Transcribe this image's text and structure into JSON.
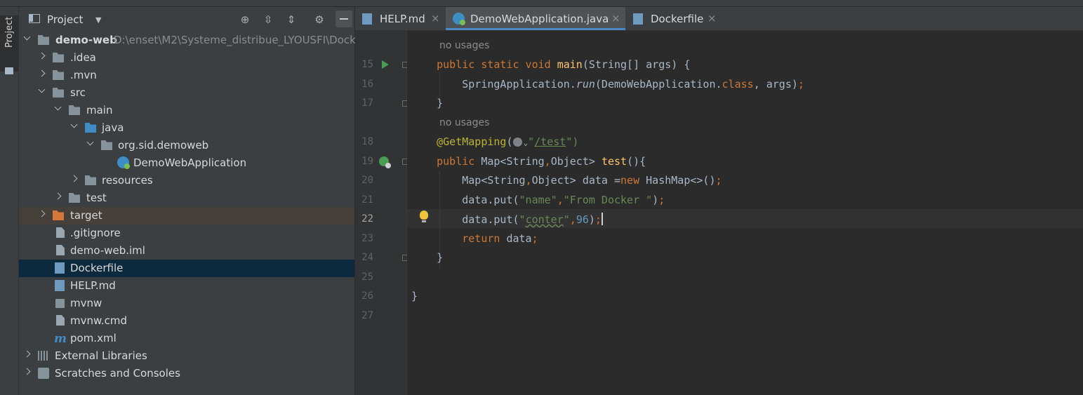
{
  "sidebar_strip": {
    "label": "Project"
  },
  "project_panel": {
    "title": "Project",
    "tree": [
      {
        "label": "demo-web",
        "path": "D:\\enset\\M2\\Systeme_distribue_LYOUSFI\\Dock"
      },
      {
        "label": ".idea"
      },
      {
        "label": ".mvn"
      },
      {
        "label": "src"
      },
      {
        "label": "main"
      },
      {
        "label": "java"
      },
      {
        "label": "org.sid.demoweb"
      },
      {
        "label": "DemoWebApplication"
      },
      {
        "label": "resources"
      },
      {
        "label": "test"
      },
      {
        "label": "target"
      },
      {
        "label": ".gitignore"
      },
      {
        "label": "demo-web.iml"
      },
      {
        "label": "Dockerfile"
      },
      {
        "label": "HELP.md"
      },
      {
        "label": "mvnw"
      },
      {
        "label": "mvnw.cmd"
      },
      {
        "label": "pom.xml"
      },
      {
        "label": "External Libraries"
      },
      {
        "label": "Scratches and Consoles"
      }
    ]
  },
  "tabs": [
    {
      "label": "HELP.md",
      "close": "×"
    },
    {
      "label": "DemoWebApplication.java",
      "close": "×"
    },
    {
      "label": "Dockerfile",
      "close": "×"
    }
  ],
  "editor": {
    "hint": "no usages",
    "line_numbers": [
      "15",
      "16",
      "17",
      "18",
      "19",
      "20",
      "21",
      "22",
      "23",
      "24",
      "25",
      "26",
      "27"
    ],
    "code": {
      "l15_kw": "public static void ",
      "l15_fn": "main",
      "l15_rest": "(String[] args) {",
      "l16_a": "SpringApplication.",
      "l16_run": "run",
      "l16_b": "(DemoWebApplication.",
      "l16_cls": "class",
      "l16_c": ", args)",
      "l16_semi": ";",
      "l17": "}",
      "l18_ann": "@GetMapping",
      "l18_open": "(",
      "l18_q": "\"",
      "l18_url": "/test",
      "l18_close": "\")",
      "l19_kw": "public ",
      "l19_type": "Map<String",
      "l19_comma": ",",
      "l19_type2": "Object> ",
      "l19_fn": "test",
      "l19_rest": "(){",
      "l20_a": "Map<String",
      "l20_comma": ",",
      "l20_b": "Object> data =",
      "l20_new": "new ",
      "l20_c": "HashMap<>()",
      "l20_semi": ";",
      "l21_a": "data.put(",
      "l21_s1": "\"name\"",
      "l21_comma": ",",
      "l21_s2": "\"From Docker \"",
      "l21_b": ")",
      "l21_semi": ";",
      "l22_a": "data.put(",
      "l22_q1": "\"",
      "l22_s1": "conter",
      "l22_q2": "\"",
      "l22_comma": ",",
      "l22_num": "96",
      "l22_b": ")",
      "l22_semi": ";",
      "l23_kw": "return ",
      "l23_a": "data",
      "l23_semi": ";",
      "l24": "}",
      "l26": "}"
    }
  },
  "colors": {
    "keyword": "#cc7832",
    "function": "#ffc66d",
    "string": "#6a8759",
    "number": "#6897bb",
    "annotation": "#bbb529",
    "selection": "#0d293e",
    "active_tab_underline": "#4a88c7"
  }
}
